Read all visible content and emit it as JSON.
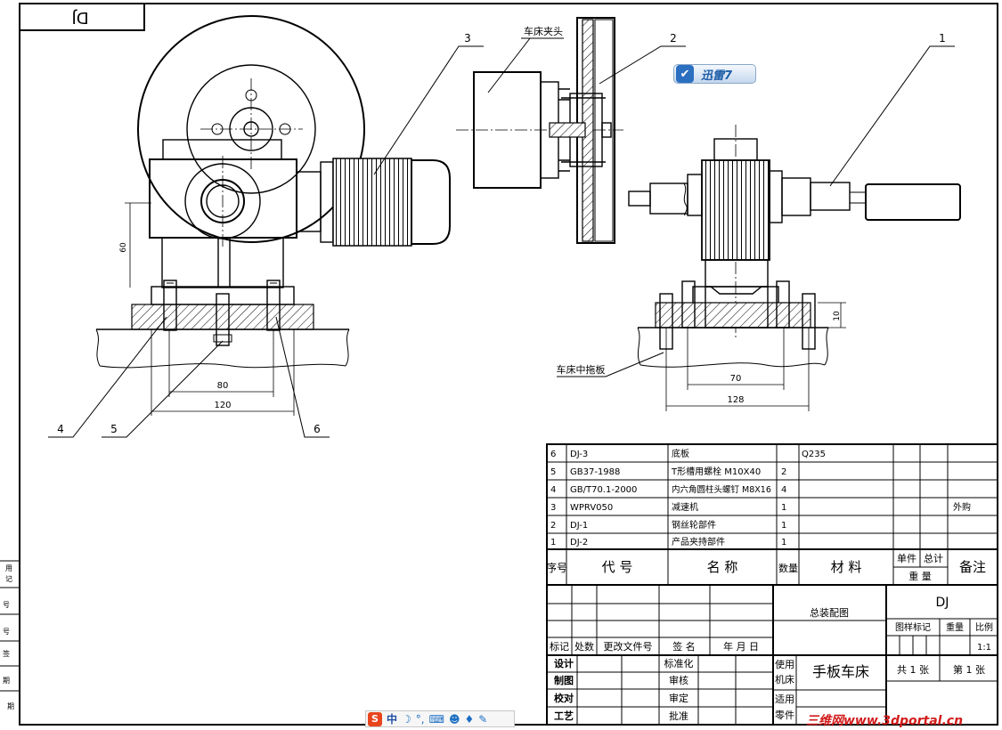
{
  "title_box": {
    "text": "DJ"
  },
  "balloons": [
    "1",
    "2",
    "3",
    "4",
    "5",
    "6"
  ],
  "labels": {
    "chuck": "车床夹头",
    "carriage": "车床中拖板"
  },
  "dimensions": {
    "height_60": "60",
    "width_80": "80",
    "width_120": "120",
    "height_10": "10",
    "width_70": "70",
    "width_128": "128"
  },
  "bom": {
    "rows": [
      {
        "no": "6",
        "code": "DJ-3",
        "name": "底板",
        "qty": "",
        "material": "Q235",
        "remark": ""
      },
      {
        "no": "5",
        "code": "GB37-1988",
        "name": "T形槽用螺栓 M10X40",
        "qty": "2",
        "material": "",
        "remark": ""
      },
      {
        "no": "4",
        "code": "GB/T70.1-2000",
        "name": "内六角圆柱头螺钉 M8X16",
        "qty": "4",
        "material": "",
        "remark": ""
      },
      {
        "no": "3",
        "code": "WPRV050",
        "name": "减速机",
        "qty": "1",
        "material": "",
        "remark": "外购"
      },
      {
        "no": "2",
        "code": "DJ-1",
        "name": "钢丝轮部件",
        "qty": "1",
        "material": "",
        "remark": ""
      },
      {
        "no": "1",
        "code": "DJ-2",
        "name": "产品夹持部件",
        "qty": "1",
        "material": "",
        "remark": ""
      }
    ],
    "header": {
      "no": "序号",
      "code": "代 号",
      "name": "名 称",
      "qty": "数量",
      "material": "材 料",
      "unit": "单件",
      "total": "总计",
      "weight": "重 量",
      "remark": "备注"
    }
  },
  "title_block": {
    "rev_headers": [
      "标记",
      "处数",
      "更改文件号",
      "签 名",
      "年 月 日"
    ],
    "roles": [
      "设计",
      "制图",
      "校对",
      "工艺"
    ],
    "approvals": [
      "标准化",
      "审核",
      "审定",
      "批准"
    ],
    "drawing_name": "总装配图",
    "drawing_code": "DJ",
    "use_label_1": "使用",
    "use_label_2": "机床",
    "machine": "手板车床",
    "apply_label_1": "适用",
    "apply_label_2": "零件",
    "mark_label": "图样标记",
    "weight_label": "重量",
    "scale_label": "比例",
    "scale_value": "1:1",
    "sheets_total": "共 1 张",
    "sheet_no": "第 1 张"
  },
  "left_strip": [
    "用",
    "记",
    "号",
    "号",
    "签",
    "期",
    "期"
  ],
  "overlays": {
    "xunlei": "迅雷7",
    "ime": "中",
    "watermark": "三维网www.3dportal.cn"
  }
}
